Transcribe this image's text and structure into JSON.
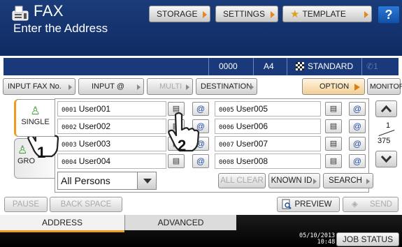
{
  "header": {
    "title": "FAX",
    "subtitle": "Enter the Address",
    "storage_label": "STORAGE",
    "settings_label": "SETTINGS",
    "template_label": "TEMPLATE",
    "help_label": "?"
  },
  "status": {
    "count": "0000",
    "paper": "A4",
    "quality": "STANDARD",
    "line": "1"
  },
  "toolbar": {
    "input_fax_no": "INPUT FAX No.",
    "input_email": "INPUT @",
    "multi": "MULTI",
    "destination": "DESTINATION",
    "option": "OPTION",
    "monitor": "MONITOR"
  },
  "tabs": {
    "single": "SINGLE",
    "group": "GRO"
  },
  "entries": [
    {
      "num": "0001",
      "name": "User001"
    },
    {
      "num": "0002",
      "name": "User002"
    },
    {
      "num": "0003",
      "name": "User003"
    },
    {
      "num": "0004",
      "name": "User004"
    },
    {
      "num": "0005",
      "name": "User005"
    },
    {
      "num": "0006",
      "name": "User006"
    },
    {
      "num": "0007",
      "name": "User007"
    },
    {
      "num": "0008",
      "name": "User008"
    }
  ],
  "icons": {
    "fax": "fax-icon",
    "email": "email-icon",
    "email_glyph": "@"
  },
  "filter": {
    "selected": "All Persons"
  },
  "panel_buttons": {
    "all_clear": "ALL CLEAR",
    "known_id": "KNOWN ID",
    "search": "SEARCH"
  },
  "paging": {
    "current": "1",
    "total": "375"
  },
  "bottom": {
    "pause": "PAUSE",
    "backspace": "BACK SPACE",
    "preview": "PREVIEW",
    "send": "SEND"
  },
  "footer": {
    "tab_address": "ADDRESS",
    "tab_advanced": "ADVANCED",
    "date": "05/10/2013",
    "time": "10:48",
    "job_status": "JOB STATUS"
  },
  "callouts": {
    "first": "1",
    "second": "2"
  },
  "colors": {
    "header_bg": "#1b3c7a",
    "accent": "#f09a20",
    "help_bg": "#1250a8"
  }
}
